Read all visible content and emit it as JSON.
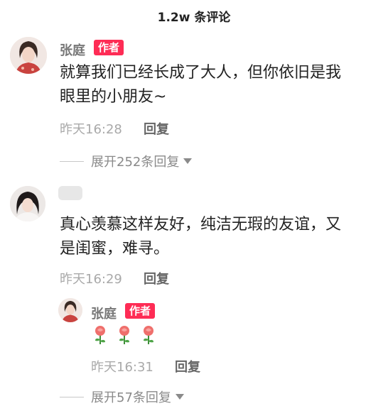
{
  "header": {
    "title": "1.2w 条评论"
  },
  "comment1": {
    "name": "张庭",
    "badge": "作者",
    "text_line1": "就算我们已经长成了大人，但你依旧是我",
    "text_line2": "眼里的小朋友~",
    "time": "昨天16:28",
    "reply_label": "回复",
    "expand_label": "展开252条回复"
  },
  "comment2": {
    "text_line1": "真心羡慕这样友好，纯洁无瑕的友谊，又",
    "text_line2": "是闺蜜，难寻。",
    "time": "昨天16:29",
    "reply_label": "回复"
  },
  "reply1": {
    "name": "张庭",
    "badge": "作者",
    "emojis": [
      "rose-icon",
      "rose-icon",
      "rose-icon"
    ],
    "time": "昨天16:31",
    "reply_label": "回复"
  },
  "footer_expand": {
    "label": "展开57条回复"
  },
  "colors": {
    "badge": "#fe2c55",
    "muted": "#a9a9a9"
  }
}
